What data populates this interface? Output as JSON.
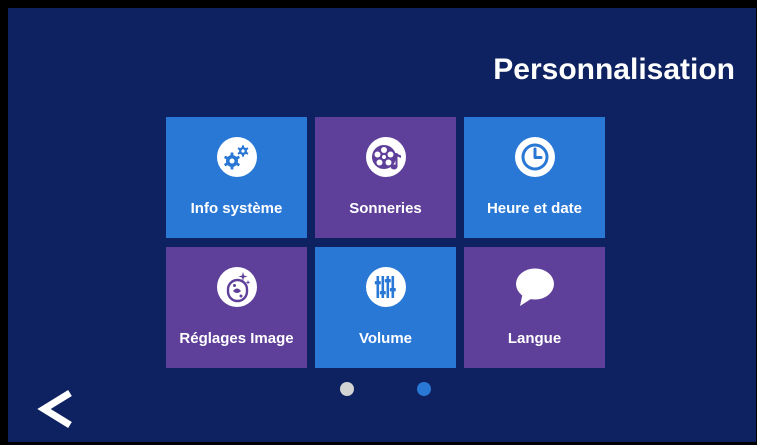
{
  "header": {
    "title": "Personnalisation"
  },
  "tiles": [
    {
      "label": "Info système",
      "icon": "gears-icon",
      "color": "#2a78d5"
    },
    {
      "label": "Sonneries",
      "icon": "music-reel-icon",
      "color": "#5e3f99"
    },
    {
      "label": "Heure et date",
      "icon": "clock-icon",
      "color": "#2a78d5"
    },
    {
      "label": "Réglages Image",
      "icon": "image-adjust-icon",
      "color": "#5e3f99"
    },
    {
      "label": "Volume",
      "icon": "equalizer-icon",
      "color": "#2a78d5"
    },
    {
      "label": "Langue",
      "icon": "speech-bubble-icon",
      "color": "#5e3f99"
    }
  ],
  "pagination": {
    "page_count": 2,
    "current_page": 2,
    "colors": {
      "inactive": "#d3d3d3",
      "active": "#2a78d5"
    }
  },
  "navigation": {
    "back_icon": "chevron-left-icon"
  },
  "theme": {
    "background": "#0e2160",
    "blue_tile": "#2a78d5",
    "purple_tile": "#5e3f99",
    "text": "#ffffff"
  }
}
